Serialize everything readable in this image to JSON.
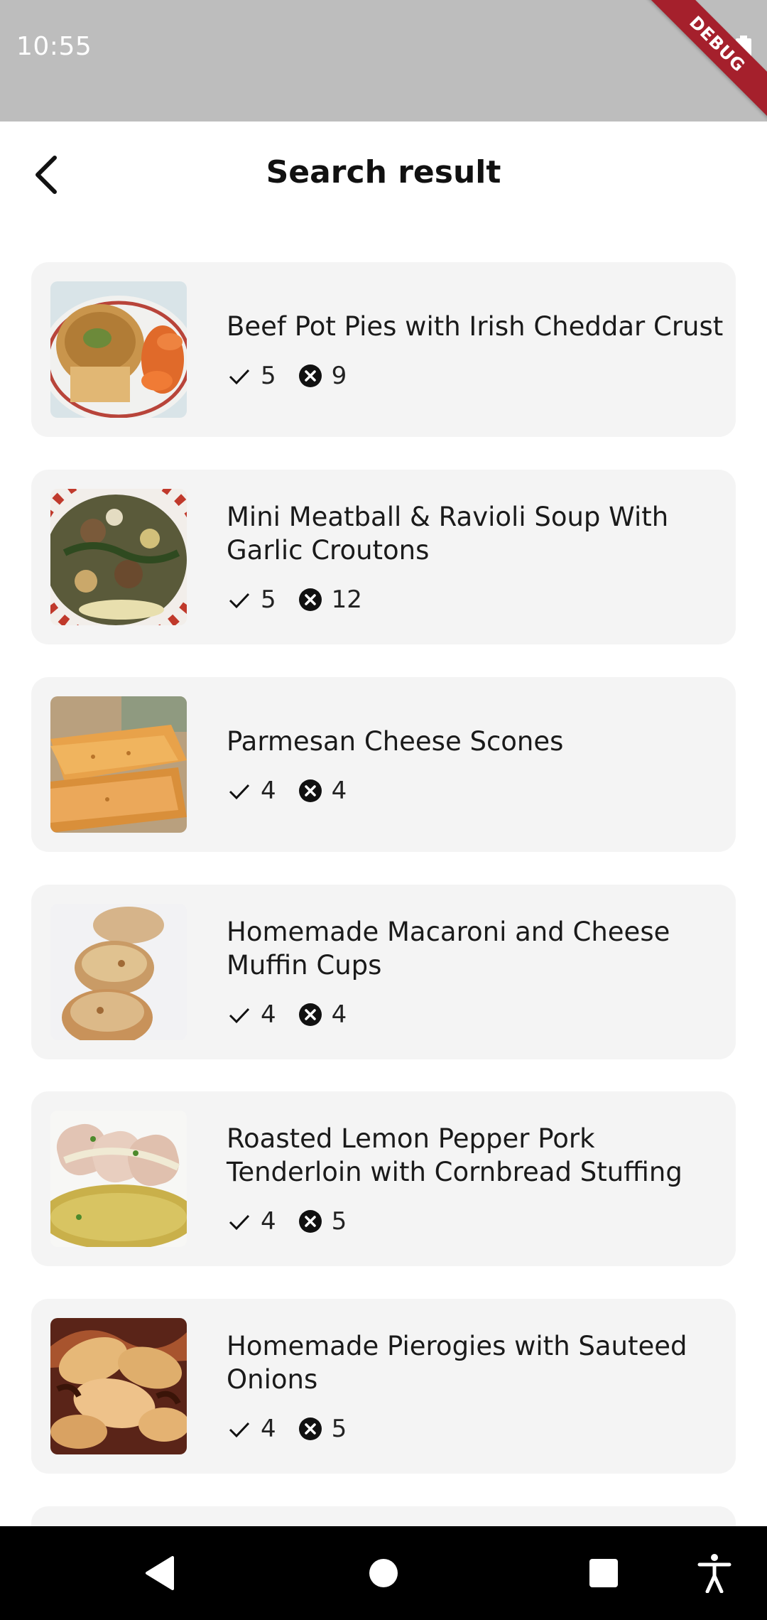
{
  "status_bar": {
    "time": "10:55",
    "debug_label": "DEBUG"
  },
  "app_bar": {
    "title": "Search result"
  },
  "recipes": [
    {
      "name": "Beef Pot Pies with Irish Cheddar Crust",
      "likes": "5",
      "dislikes": "9",
      "image": "pot-pie-photo"
    },
    {
      "name": "Mini Meatball & Ravioli Soup With Garlic Croutons",
      "likes": "5",
      "dislikes": "12",
      "image": "meatball-soup-photo"
    },
    {
      "name": "Parmesan Cheese Scones",
      "likes": "4",
      "dislikes": "4",
      "image": "scones-photo"
    },
    {
      "name": "Homemade Macaroni and Cheese Muffin Cups",
      "likes": "4",
      "dislikes": "4",
      "image": "mac-cheese-cups-photo"
    },
    {
      "name": "Roasted Lemon Pepper Pork Tenderloin with Cornbread Stuffing",
      "likes": "4",
      "dislikes": "5",
      "image": "pork-tenderloin-photo"
    },
    {
      "name": "Homemade Pierogies with Sauteed Onions",
      "likes": "4",
      "dislikes": "5",
      "image": "pierogies-photo"
    }
  ],
  "icons": {
    "back": "arrow-back-icon",
    "like": "check-icon",
    "dislike": "cancel-circle-icon",
    "nav_back": "nav-back-icon",
    "nav_home": "nav-home-icon",
    "nav_recents": "nav-recents-icon",
    "accessibility": "accessibility-icon"
  },
  "colors": {
    "status_bar": "#bdbdbd",
    "card_bg": "#f4f4f4",
    "debug_banner": "#a5202c",
    "nav_bar": "#000000"
  }
}
